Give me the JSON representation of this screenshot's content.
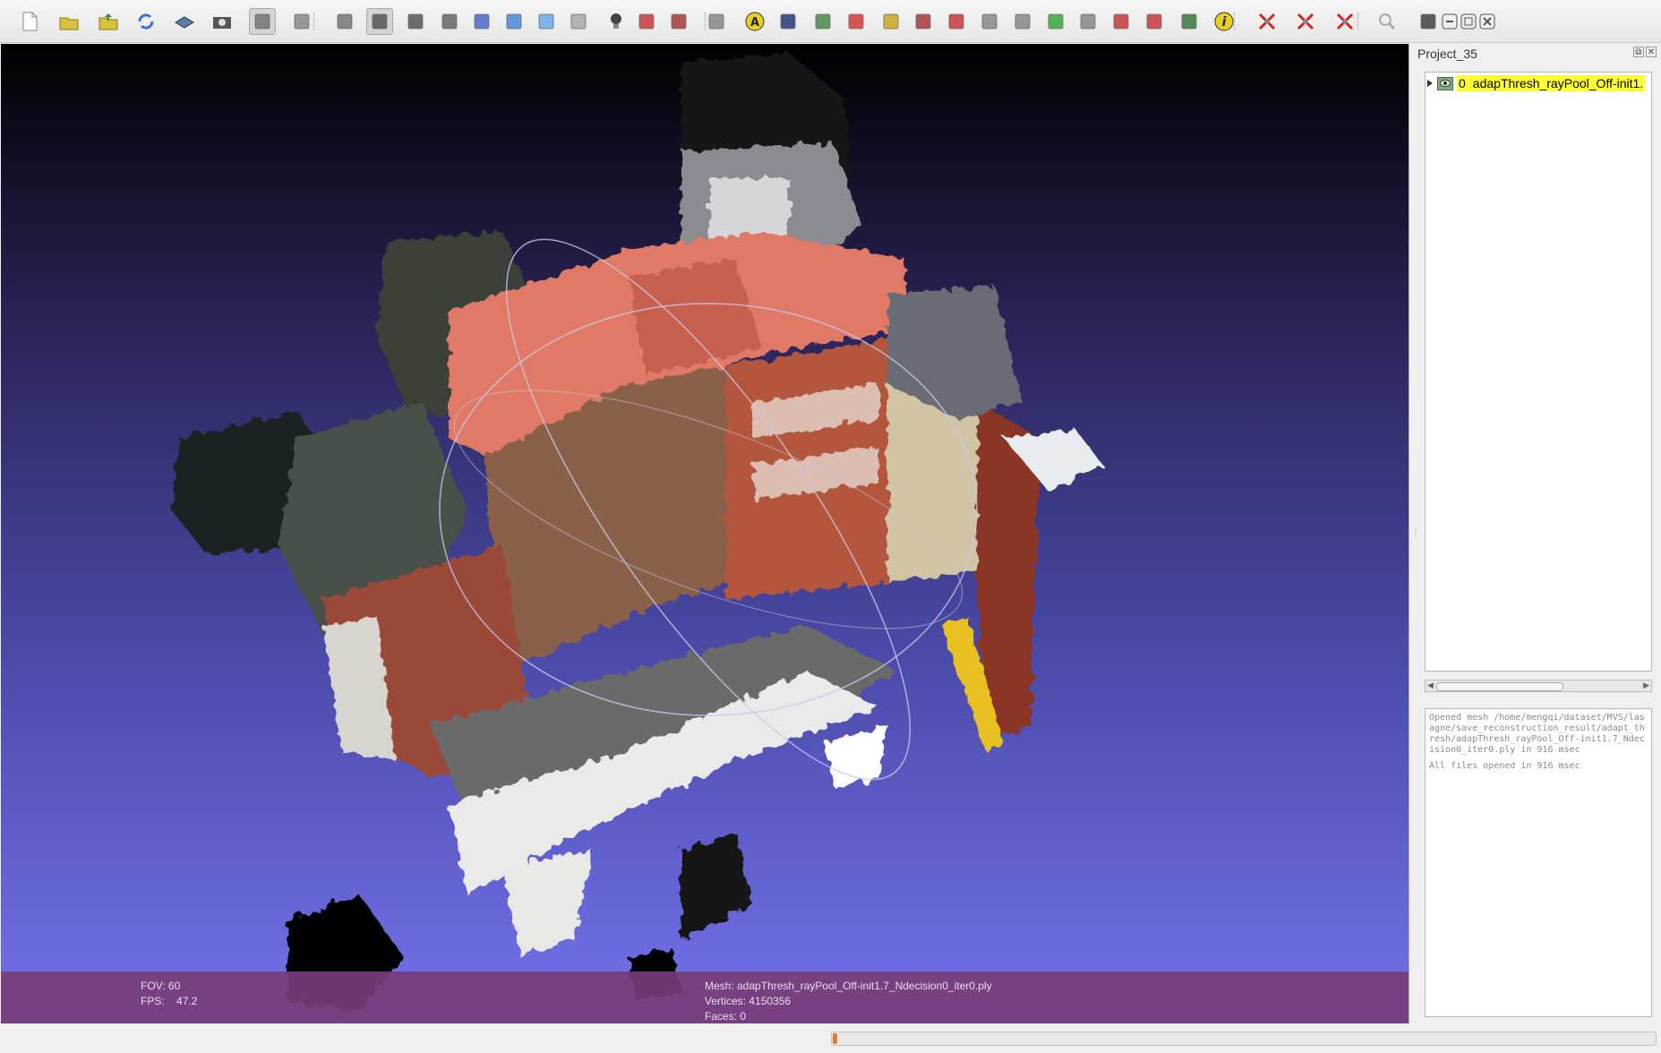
{
  "toolbar": {
    "items": [
      {
        "name": "new-project-icon",
        "color": "#ffffff"
      },
      {
        "name": "open-project-icon",
        "color": "#d8c23a"
      },
      {
        "name": "import-mesh-icon",
        "color": "#d8c23a"
      },
      {
        "name": "reload-icon",
        "color": "#3a6fd8"
      },
      {
        "name": "export-mesh-icon",
        "color": "#5a7aa8"
      },
      {
        "name": "snapshot-icon",
        "color": "#555555"
      },
      {
        "name": "layers-icon",
        "color": "#777777",
        "active": true
      },
      {
        "name": "light-sphere-icon",
        "color": "#888888"
      },
      {
        "name": "bounding-box-icon",
        "color": "#777777"
      },
      {
        "name": "points-icon",
        "color": "#555555",
        "active": true
      },
      {
        "name": "wireframe-icon",
        "color": "#555555"
      },
      {
        "name": "hidden-lines-icon",
        "color": "#666666"
      },
      {
        "name": "flat-lines-icon",
        "color": "#4a6ac8"
      },
      {
        "name": "flat-shading-icon",
        "color": "#4a8ad8"
      },
      {
        "name": "smooth-shading-icon",
        "color": "#6aaae8"
      },
      {
        "name": "texture-icon",
        "color": "#aaaaaa"
      },
      {
        "name": "light-bulb-icon",
        "color": "#444444"
      },
      {
        "name": "color-fill-icon",
        "color": "#c83a3a"
      },
      {
        "name": "back-face-icon",
        "color": "#a83a3a"
      },
      {
        "name": "selection-icon",
        "color": "#888888"
      },
      {
        "name": "annotation-a-icon",
        "color": "#e8d020"
      },
      {
        "name": "raster-icon",
        "color": "#2a3a7a"
      },
      {
        "name": "measure-globe-icon",
        "color": "#4a8a4a"
      },
      {
        "name": "axis-icon",
        "color": "#d83a3a"
      },
      {
        "name": "paint-icon",
        "color": "#c8a820"
      },
      {
        "name": "brush-icon",
        "color": "#a83a3a"
      },
      {
        "name": "pick-points-icon",
        "color": "#c83a3a"
      },
      {
        "name": "align-icon",
        "color": "#888888"
      },
      {
        "name": "manipulator-icon",
        "color": "#888888"
      },
      {
        "name": "colorize-icon",
        "color": "#3aa83a"
      },
      {
        "name": "select-faces-icon",
        "color": "#888888"
      },
      {
        "name": "select-vertices-icon",
        "color": "#c83a3a"
      },
      {
        "name": "select-connected-icon",
        "color": "#c83a3a"
      },
      {
        "name": "raster-view-icon",
        "color": "#3a7a3a"
      },
      {
        "name": "info-icon",
        "color": "#e8d020"
      },
      {
        "name": "delete-selected-faces-icon",
        "color": "#d82020"
      },
      {
        "name": "delete-selected-vertices-icon",
        "color": "#d82020"
      },
      {
        "name": "delete-selected-edges-icon",
        "color": "#d82020"
      },
      {
        "name": "search-icon",
        "color": "#aaaaaa"
      },
      {
        "name": "quick-view-icon",
        "color": "#444444"
      },
      {
        "name": "minimize-icon",
        "color": "#555555"
      },
      {
        "name": "restore-icon",
        "color": "#555555"
      },
      {
        "name": "close-window-icon",
        "color": "#555555"
      }
    ]
  },
  "viewport": {
    "fov_label": "FOV:",
    "fov_value": "60",
    "fps_label": "FPS:",
    "fps_value": "47.2",
    "mesh_line": "Mesh: adapThresh_rayPool_Off-init1.7_Ndecision0_iter0.ply",
    "vertices_line": "Vertices: 4150356",
    "faces_line": "Faces: 0"
  },
  "panel": {
    "title": "Project_35",
    "float_button": "⧉",
    "close_button": "✕",
    "layer": {
      "index": "0",
      "name": "adapThresh_rayPool_Off-init1."
    },
    "log": [
      "Opened mesh /home/mengqi/dataset/MVS/lasagne/save_reconstruction_result/adapt_thresh/adapThresh_rayPool_Off-init1.7_Ndecision0_iter0.ply in 916 msec",
      "All files opened in 916 msec"
    ]
  },
  "status": {
    "progress_fraction": 0.005
  }
}
